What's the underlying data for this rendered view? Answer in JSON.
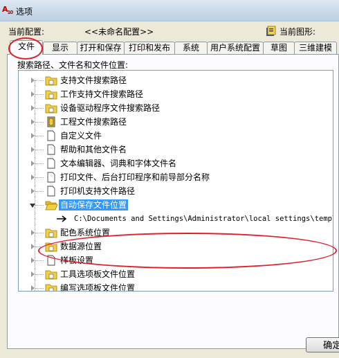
{
  "window": {
    "title": "选项",
    "app_icon": "autocad-icon"
  },
  "profile": {
    "current_profile_label": "当前配置:",
    "current_profile_value": "<<未命名配置>>",
    "current_drawing_label": "当前图形:"
  },
  "tabs": [
    {
      "label": "文件",
      "active": true
    },
    {
      "label": "显示"
    },
    {
      "label": "打开和保存"
    },
    {
      "label": "打印和发布"
    },
    {
      "label": "系统"
    },
    {
      "label": "用户系统配置"
    },
    {
      "label": "草图"
    },
    {
      "label": "三维建模"
    }
  ],
  "panel": {
    "label": "搜索路径、文件名和文件位置:"
  },
  "tree": {
    "items": [
      {
        "label": "支持文件搜索路径",
        "icon": "folder-icon"
      },
      {
        "label": "工作支持文件搜索路径",
        "icon": "folder-icon"
      },
      {
        "label": "设备驱动程序文件搜索路径",
        "icon": "folder-icon"
      },
      {
        "label": "工程文件搜索路径",
        "icon": "project-file-icon"
      },
      {
        "label": "自定义文件",
        "icon": "document-icon"
      },
      {
        "label": "帮助和其他文件名",
        "icon": "document-icon"
      },
      {
        "label": "文本编辑器、词典和字体文件名",
        "icon": "document-icon"
      },
      {
        "label": "打印文件、后台打印程序和前导部分名称",
        "icon": "document-icon"
      },
      {
        "label": "打印机支持文件路径",
        "icon": "document-icon"
      },
      {
        "label": "自动保存文件位置",
        "icon": "open-folder-icon",
        "expanded": true,
        "selected": true
      },
      {
        "label": "配色系统位置",
        "icon": "folder-icon"
      },
      {
        "label": "数据源位置",
        "icon": "folder-icon"
      },
      {
        "label": "样板设置",
        "icon": "document-icon"
      },
      {
        "label": "工具选项板文件位置",
        "icon": "folder-icon"
      },
      {
        "label": "编写选项板文件位置",
        "icon": "folder-icon"
      }
    ],
    "autosave_path": "C:\\Documents and Settings\\Administrator\\local settings\\temp\\"
  },
  "buttons": {
    "ok": "确定"
  },
  "colors": {
    "annotation_red": "#e0202a",
    "selection_blue": "#3399ff"
  }
}
